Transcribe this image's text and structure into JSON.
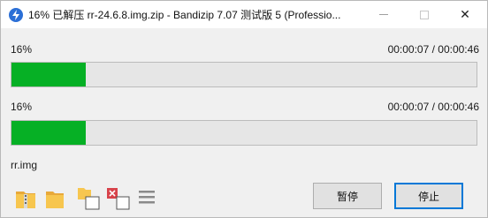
{
  "window": {
    "title": "16% 已解压 rr-24.6.8.img.zip - Bandizip 7.07 测试版 5 (Professio...",
    "close_glyph": "✕"
  },
  "progress": [
    {
      "percent_label": "16%",
      "time_label": "00:00:07 / 00:00:46",
      "fraction": 0.16
    },
    {
      "percent_label": "16%",
      "time_label": "00:00:07 / 00:00:46",
      "fraction": 0.16
    }
  ],
  "current_file": "rr.img",
  "toolbar": {
    "icons": [
      "zip-folder-icon",
      "open-folder-icon",
      "copy-files-icon",
      "delete-files-icon",
      "menu-icon"
    ]
  },
  "buttons": {
    "pause_label": "暂停",
    "stop_label": "停止"
  },
  "colors": {
    "progress_fill": "#06b025",
    "progress_track": "#e6e6e6",
    "accent": "#0078d7"
  }
}
